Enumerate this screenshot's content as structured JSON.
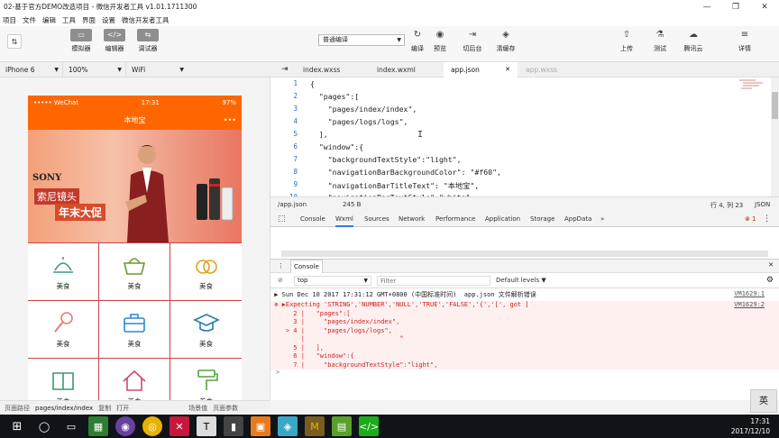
{
  "window": {
    "title": "02-基于官方DEMO改造项目 - 微信开发者工具 v1.01.1711300",
    "min": "—",
    "max": "❐",
    "close": "✕"
  },
  "menu": [
    "项目",
    "文件",
    "编辑",
    "工具",
    "界面",
    "设置",
    "微信开发者工具"
  ],
  "toolbar": {
    "avatar": "⇅",
    "left": [
      {
        "label": "模拟器",
        "icon": "▭"
      },
      {
        "label": "编辑器",
        "icon": "</>"
      },
      {
        "label": "调试器",
        "icon": "⇆"
      }
    ],
    "mode_select": "普通编译",
    "center": [
      {
        "label": "编译",
        "icon": "↻"
      },
      {
        "label": "预览",
        "icon": "◉"
      },
      {
        "label": "切后台",
        "icon": "⇥"
      },
      {
        "label": "清缓存",
        "icon": "◈"
      }
    ],
    "right": [
      {
        "label": "上传",
        "icon": "⇧"
      },
      {
        "label": "测试",
        "icon": "⚗"
      },
      {
        "label": "腾讯云",
        "icon": "☁"
      },
      {
        "label": "详情",
        "icon": "≡"
      }
    ]
  },
  "device": {
    "model": "iPhone 6",
    "zoom": "100%",
    "network": "WiFi"
  },
  "phone": {
    "carrier": "••••• WeChat",
    "time": "17:31",
    "battery": "97%",
    "nav_title": "本地宝",
    "nav_dots": "•••",
    "banner": {
      "brand": "SONY",
      "line1": "索尼镜头",
      "line2": "年末大促"
    },
    "grid": [
      {
        "label": "美食",
        "icon": "dish-icon"
      },
      {
        "label": "美食",
        "icon": "basket-icon"
      },
      {
        "label": "美食",
        "icon": "rings-icon"
      },
      {
        "label": "美食",
        "icon": "microphone-icon"
      },
      {
        "label": "美食",
        "icon": "briefcase-icon"
      },
      {
        "label": "美食",
        "icon": "graduation-cap-icon"
      },
      {
        "label": "美食",
        "icon": "book-icon"
      },
      {
        "label": "美食",
        "icon": "house-icon"
      },
      {
        "label": "美食",
        "icon": "paint-roller-icon"
      }
    ]
  },
  "sim_footer": {
    "label": "页面路径",
    "path": "pages/index/index",
    "copy": "复制",
    "open": "打开",
    "scene": "场景值",
    "params": "页面参数"
  },
  "editor_tabs": [
    "index.wxss",
    "index.wxml",
    "app.json",
    "app.wxss"
  ],
  "editor_tab_close": "✕",
  "editor_lines": [
    {
      "n": "1",
      "t": "{"
    },
    {
      "n": "2",
      "t": "  \"pages\":["
    },
    {
      "n": "3",
      "t": "    \"pages/index/index\","
    },
    {
      "n": "4",
      "t": "    \"pages/logs/logs\","
    },
    {
      "n": "5",
      "t": "  ],"
    },
    {
      "n": "6",
      "t": "  \"window\":{"
    },
    {
      "n": "7",
      "t": "    \"backgroundTextStyle\":\"light\","
    },
    {
      "n": "8",
      "t": "    \"navigationBarBackgroundColor\": \"#f60\","
    },
    {
      "n": "9",
      "t": "    \"navigationBarTitleText\": \"本地宝\","
    },
    {
      "n": "10",
      "t": "    \"navigationBarTextStyle\":\"white\""
    }
  ],
  "editor_status": {
    "file": "/app.json",
    "size": "245 B",
    "position": "行 4, 列 23",
    "lang": "JSON"
  },
  "devtools_tabs": [
    "Console",
    "Wxml",
    "Sources",
    "Network",
    "Performance",
    "Application",
    "Storage",
    "AppData"
  ],
  "devtools_more": "»",
  "error_count": "1",
  "console_panel_label": "Console",
  "console_filter": {
    "context": "top",
    "placeholder": "Filter",
    "levels": "Default levels"
  },
  "console_rows": [
    {
      "text": " ▶ Sun Dec 10 2017 17:31:12 GMT+0800 (中国标准时间)  app.json 文件解析错误",
      "link": "VM1629:1",
      "kind": "info"
    },
    {
      "text": " ⊗ ▶Expecting 'STRING','NUMBER','NULL','TRUE','FALSE','{','[', got ]",
      "link": "VM1629:2",
      "kind": "err"
    },
    {
      "text": "      2 |   \"pages\":[",
      "link": "",
      "kind": "err"
    },
    {
      "text": "      3 |     \"pages/index/index\",",
      "link": "",
      "kind": "err"
    },
    {
      "text": "    > 4 |     \"pages/logs/logs\",",
      "link": "",
      "kind": "err"
    },
    {
      "text": "        |                         ^",
      "link": "",
      "kind": "err"
    },
    {
      "text": "      5 |   ],",
      "link": "",
      "kind": "err"
    },
    {
      "text": "      6 |   \"window\":{",
      "link": "",
      "kind": "err"
    },
    {
      "text": "      7 |     \"backgroundTextStyle\":\"light\",",
      "link": "",
      "kind": "err"
    }
  ],
  "console_prompt": ">",
  "ime": "英",
  "taskbar": {
    "time": "17:31",
    "date": "2017/12/10"
  },
  "colors": {
    "nav_orange": "#ff6600",
    "grid_line": "#cc4444",
    "accent": "#3879d9",
    "error": "#cc2222"
  }
}
